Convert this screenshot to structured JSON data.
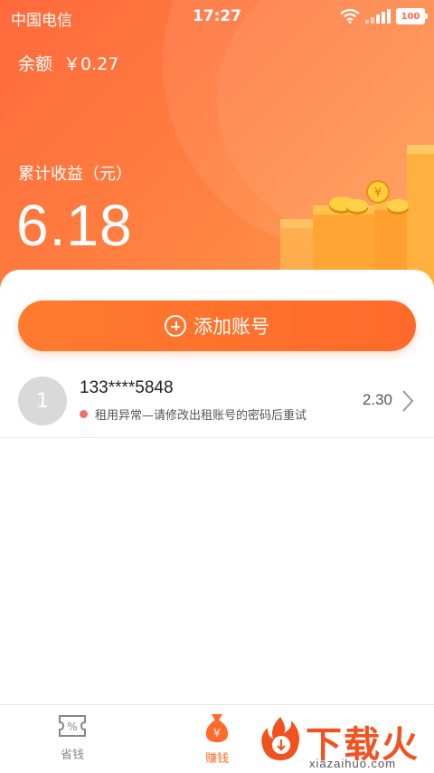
{
  "status_bar": {
    "carrier": "中国电信",
    "time": "17:27",
    "battery": "100"
  },
  "header": {
    "balance_label": "余额",
    "balance_amount": "￥0.27",
    "earnings_label": "累计收益（元）",
    "earnings_value": "6.18"
  },
  "actions": {
    "add_account_label": "添加账号"
  },
  "accounts": [
    {
      "avatar_text": "1",
      "phone": "133****5848",
      "status": "租用异常—请修改出租账号的密码后重试",
      "status_color": "#f07070",
      "amount": "2.30"
    }
  ],
  "tabs": [
    {
      "label": "省钱",
      "icon": "coupon-icon",
      "active": false
    },
    {
      "label": "赚钱",
      "icon": "moneybag-icon",
      "active": true
    }
  ],
  "watermark": {
    "title": "下载火",
    "url": "xiazaihuo.com"
  },
  "colors": {
    "accent": "#ff6a2a",
    "header_start": "#ff6a3d",
    "header_end": "#ff9a4a"
  }
}
